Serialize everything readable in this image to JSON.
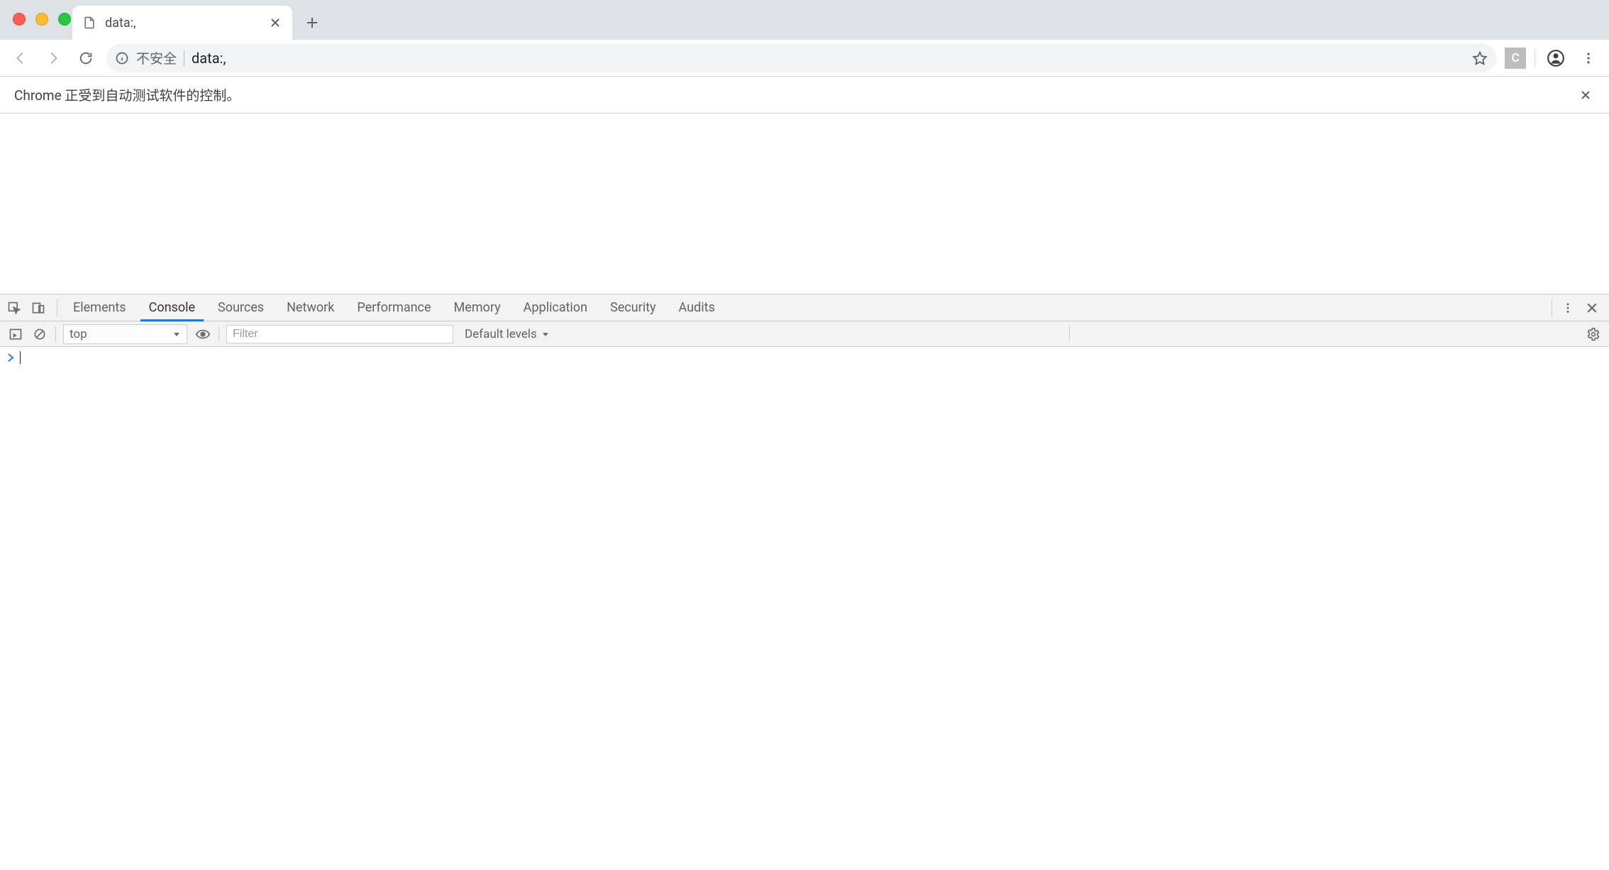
{
  "window": {
    "tab_title": "data:,",
    "new_tab_tooltip": "New Tab"
  },
  "toolbar": {
    "insecure_label": "不安全",
    "url": "data:,"
  },
  "infobar": {
    "message": "Chrome 正受到自动测试软件的控制。"
  },
  "extension": {
    "badge_letter": "C"
  },
  "devtools": {
    "tabs": [
      "Elements",
      "Console",
      "Sources",
      "Network",
      "Performance",
      "Memory",
      "Application",
      "Security",
      "Audits"
    ],
    "active_tab_index": 1,
    "console_bar": {
      "context": "top",
      "filter_placeholder": "Filter",
      "levels_label": "Default levels"
    }
  }
}
